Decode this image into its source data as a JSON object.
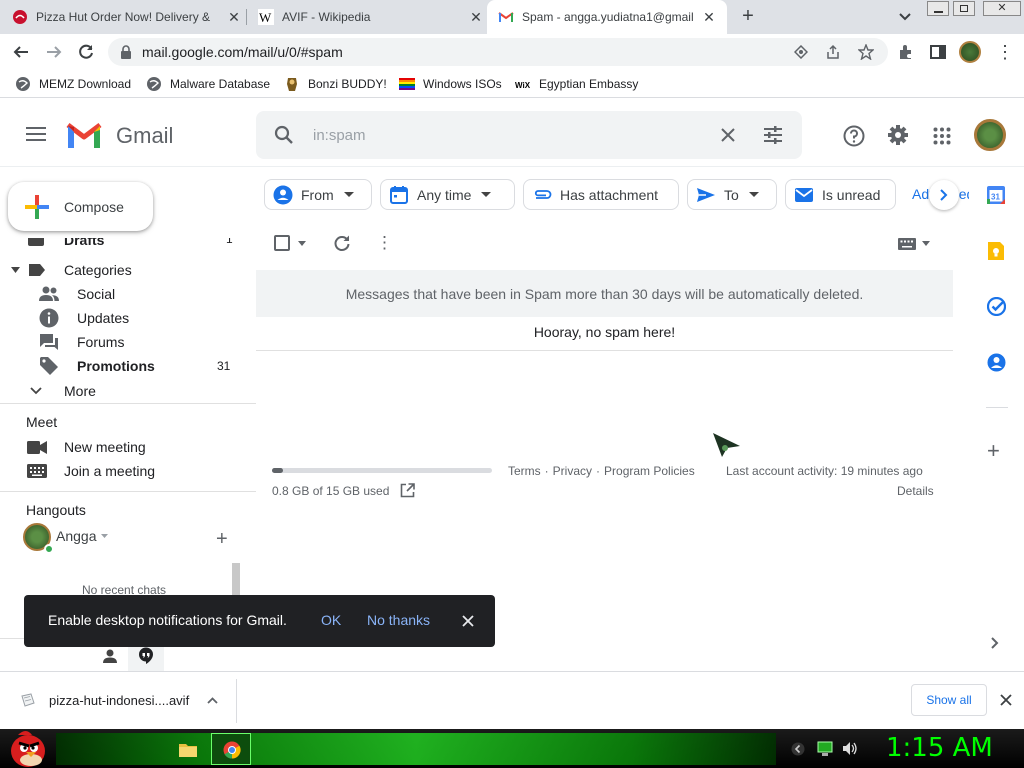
{
  "browser": {
    "tabs": [
      {
        "title": "Pizza Hut Order Now! Delivery &",
        "active": false
      },
      {
        "title": "AVIF - Wikipedia",
        "active": false
      },
      {
        "title": "Spam - angga.yudiatna1@gmail",
        "active": true
      }
    ],
    "url": "mail.google.com/mail/u/0/#spam",
    "bookmarks": [
      "MEMZ Download",
      "Malware Database",
      "Bonzi BUDDY!",
      "Windows ISOs",
      "Egyptian Embassy"
    ]
  },
  "gmail": {
    "logo_text": "Gmail",
    "search_value": "in:spam",
    "compose_label": "Compose",
    "sidebar": {
      "drafts_label": "Drafts",
      "drafts_count": "1",
      "categories_label": "Categories",
      "items": [
        {
          "label": "Social",
          "icon": "people-icon",
          "count": ""
        },
        {
          "label": "Updates",
          "icon": "info-icon",
          "count": ""
        },
        {
          "label": "Forums",
          "icon": "forum-icon",
          "count": ""
        },
        {
          "label": "Promotions",
          "icon": "tag-icon",
          "count": "31"
        }
      ],
      "more_label": "More",
      "meet_heading": "Meet",
      "new_meeting_label": "New meeting",
      "join_meeting_label": "Join a meeting",
      "hangouts_heading": "Hangouts",
      "hangouts_user": "Angga",
      "no_recent_chats": "No recent chats"
    },
    "filter_chips": [
      "From",
      "Any time",
      "Has attachment",
      "To",
      "Is unread",
      "Advanced search"
    ],
    "spam_notice": "Messages that have been in Spam more than 30 days will be automatically deleted.",
    "empty_message": "Hooray, no spam here!",
    "footer": {
      "storage_used": "0.8 GB of 15 GB used",
      "storage_fraction": 0.05,
      "terms": "Terms",
      "privacy": "Privacy",
      "program_policies": "Program Policies",
      "sep": "·",
      "last_activity": "Last account activity: 19 minutes ago",
      "details": "Details"
    },
    "snackbar": {
      "message": "Enable desktop notifications for Gmail.",
      "ok_label": "OK",
      "no_thanks_label": "No thanks"
    }
  },
  "downloads": {
    "file_name": "pizza-hut-indonesi....avif",
    "show_all_label": "Show all"
  },
  "taskbar": {
    "clock": "1:15 AM"
  },
  "colors": {
    "gmail_red": "#EA4335",
    "link_blue": "#8ab4f8",
    "chip_blue": "#1a73e8",
    "clock_green": "#00ff00"
  }
}
